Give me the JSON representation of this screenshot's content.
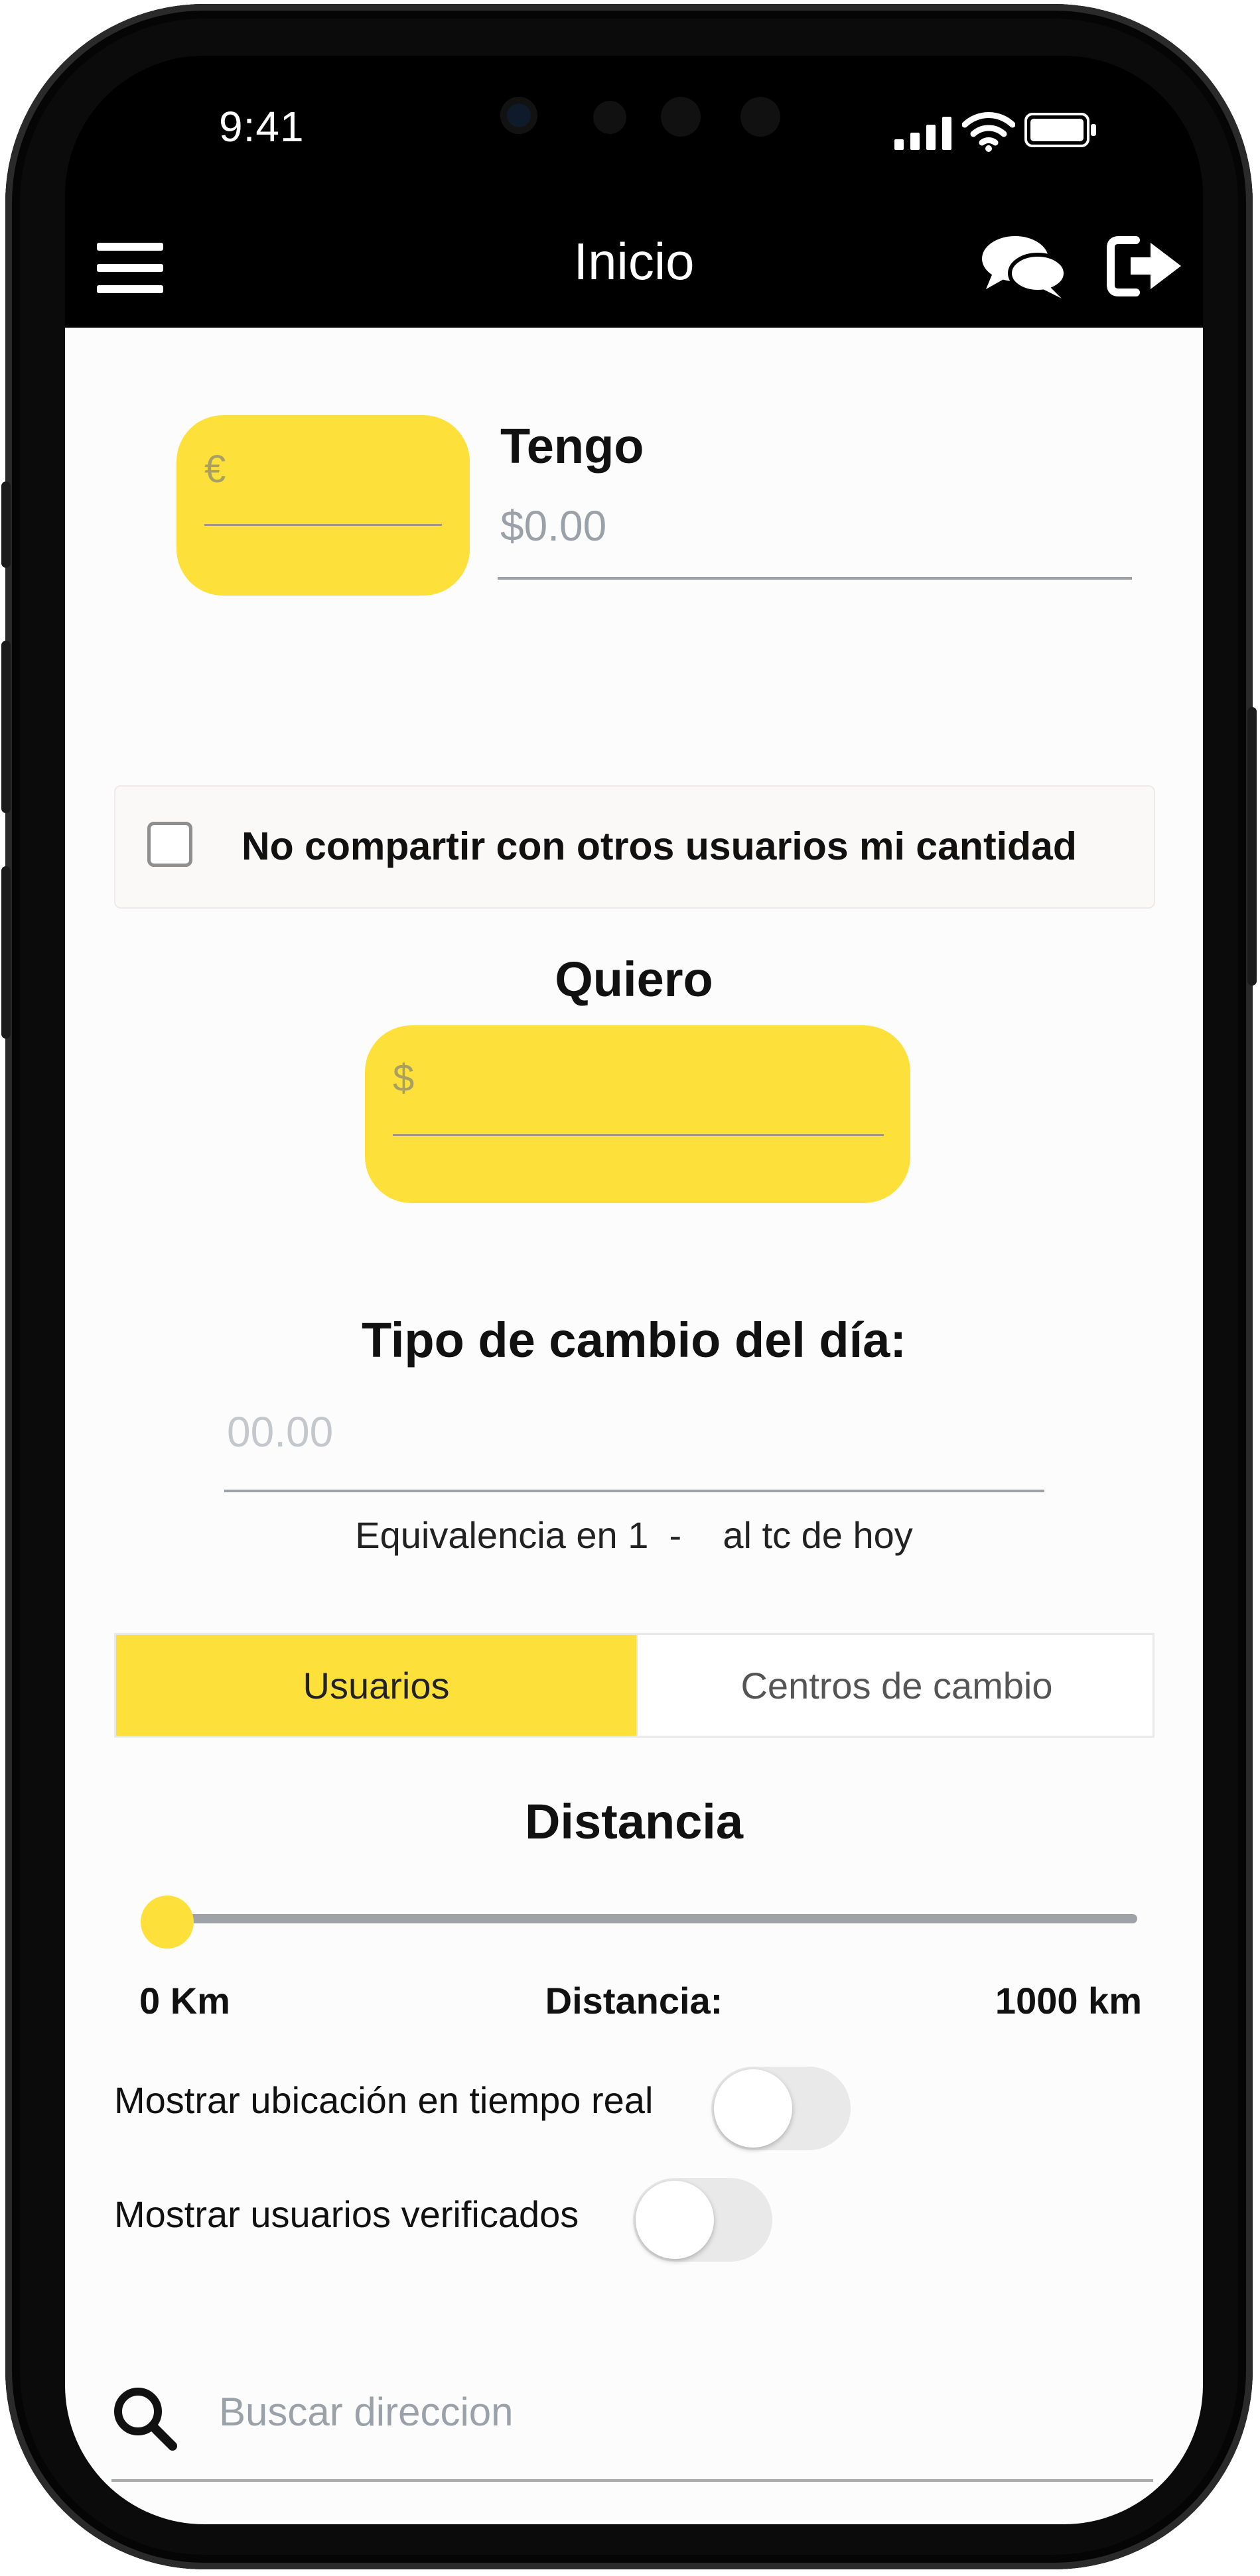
{
  "status_bar": {
    "time": "9:41"
  },
  "nav": {
    "title": "Inicio"
  },
  "tengo": {
    "label": "Tengo",
    "currency_symbol": "€",
    "amount_placeholder": "$0.00"
  },
  "privacy": {
    "label": "No compartir con otros usuarios mi cantidad",
    "checked": false
  },
  "quiero": {
    "label": "Quiero",
    "currency_symbol": "$"
  },
  "exchange": {
    "label": "Tipo de cambio del día:",
    "placeholder": "00.00",
    "note": "Equivalencia en 1  -    al tc de hoy"
  },
  "tabs": [
    {
      "label": "Usuarios",
      "active": true
    },
    {
      "label": "Centros de cambio",
      "active": false
    }
  ],
  "distance": {
    "title": "Distancia",
    "min_label": "0 Km",
    "center_label": "Distancia:",
    "max_label": "1000 km",
    "value_fraction": 0
  },
  "toggles": [
    {
      "label": "Mostrar ubicación en tiempo real",
      "on": false
    },
    {
      "label": "Mostrar usuarios verificados",
      "on": false
    }
  ],
  "search": {
    "placeholder": "Buscar direccion"
  },
  "colors": {
    "accent": "#fde03a",
    "bar": "#000000",
    "background": "#fdfcfc"
  },
  "icons": [
    "menu-icon",
    "chat-icon",
    "logout-icon",
    "search-icon",
    "signal-icon",
    "wifi-icon",
    "battery-icon"
  ]
}
